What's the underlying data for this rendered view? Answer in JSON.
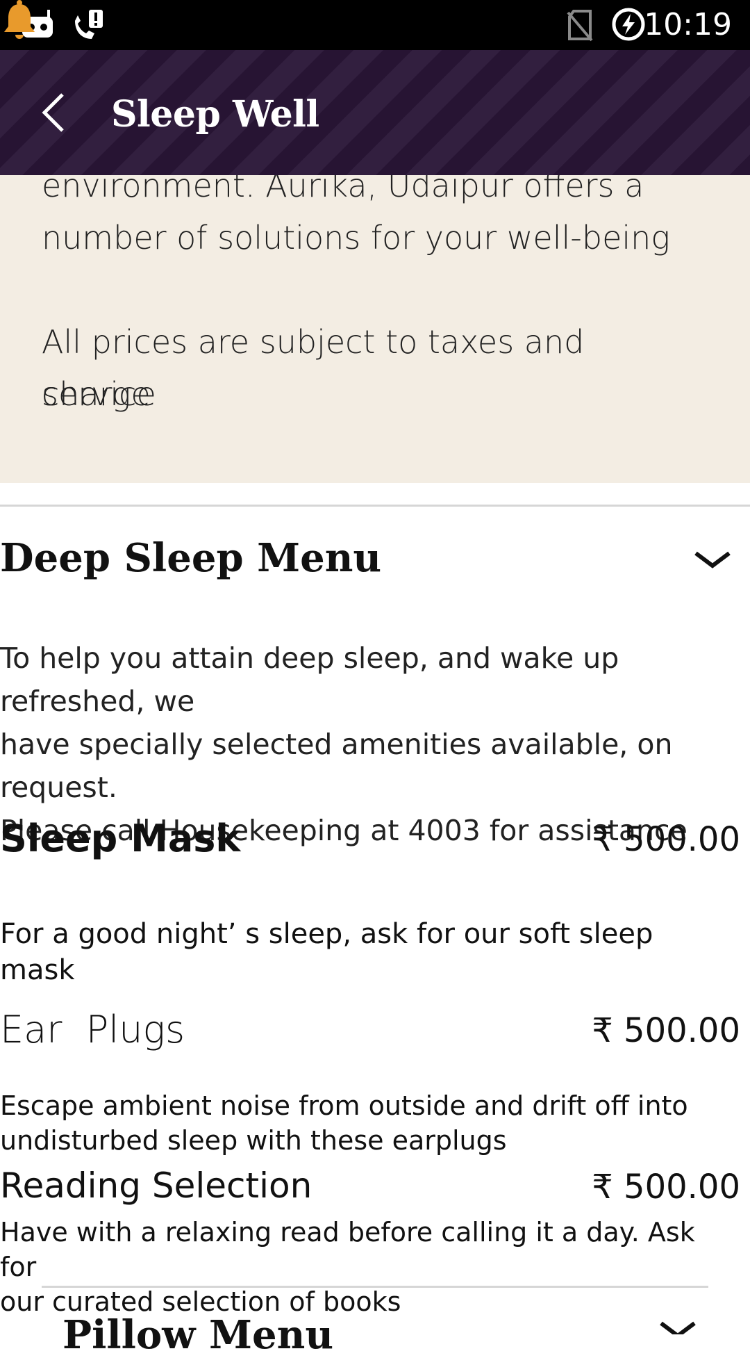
{
  "status_bar": {
    "time": "10:19",
    "icons": [
      "android-debug-icon",
      "phone-alert-icon",
      "no-sim-icon",
      "battery-charging-icon"
    ]
  },
  "app_bar": {
    "title": "Sleep Well",
    "back_icon": "chevron-left-icon",
    "notification_icon": "bell-icon",
    "accent_color": "#e89a2c",
    "background_color": "#2a1637"
  },
  "intro": {
    "partial_line": "environment. Aurika, Udaipur offers a",
    "line2": "number of solutions for your well-being",
    "taxes_line1": "All prices are subject to taxes and service",
    "taxes_line2": "charge",
    "background_color": "#f3ede3"
  },
  "deep_sleep_menu": {
    "title": "Deep Sleep Menu",
    "expanded": true,
    "description_lines": [
      "To help you attain deep sleep, and wake up refreshed, we",
      "have specially selected amenities available, on request.",
      "Please call Housekeeping at 4003 for assistance"
    ],
    "items": [
      {
        "name": "Sleep Mask",
        "price": "₹ 500.00",
        "description_lines": [
          "For a good night’ s sleep, ask for our soft sleep mask"
        ]
      },
      {
        "name": "Ear  Plugs",
        "price": "₹ 500.00",
        "description_lines": [
          "Escape ambient noise from outside and drift off into",
          "undisturbed sleep with these earplugs"
        ]
      },
      {
        "name": "Reading Selection",
        "price": "₹ 500.00",
        "description_lines": [
          "Have with a relaxing read before calling it a day. Ask for",
          "our curated selection of books"
        ]
      }
    ]
  },
  "next_section": {
    "title": "Pillow Menu"
  }
}
